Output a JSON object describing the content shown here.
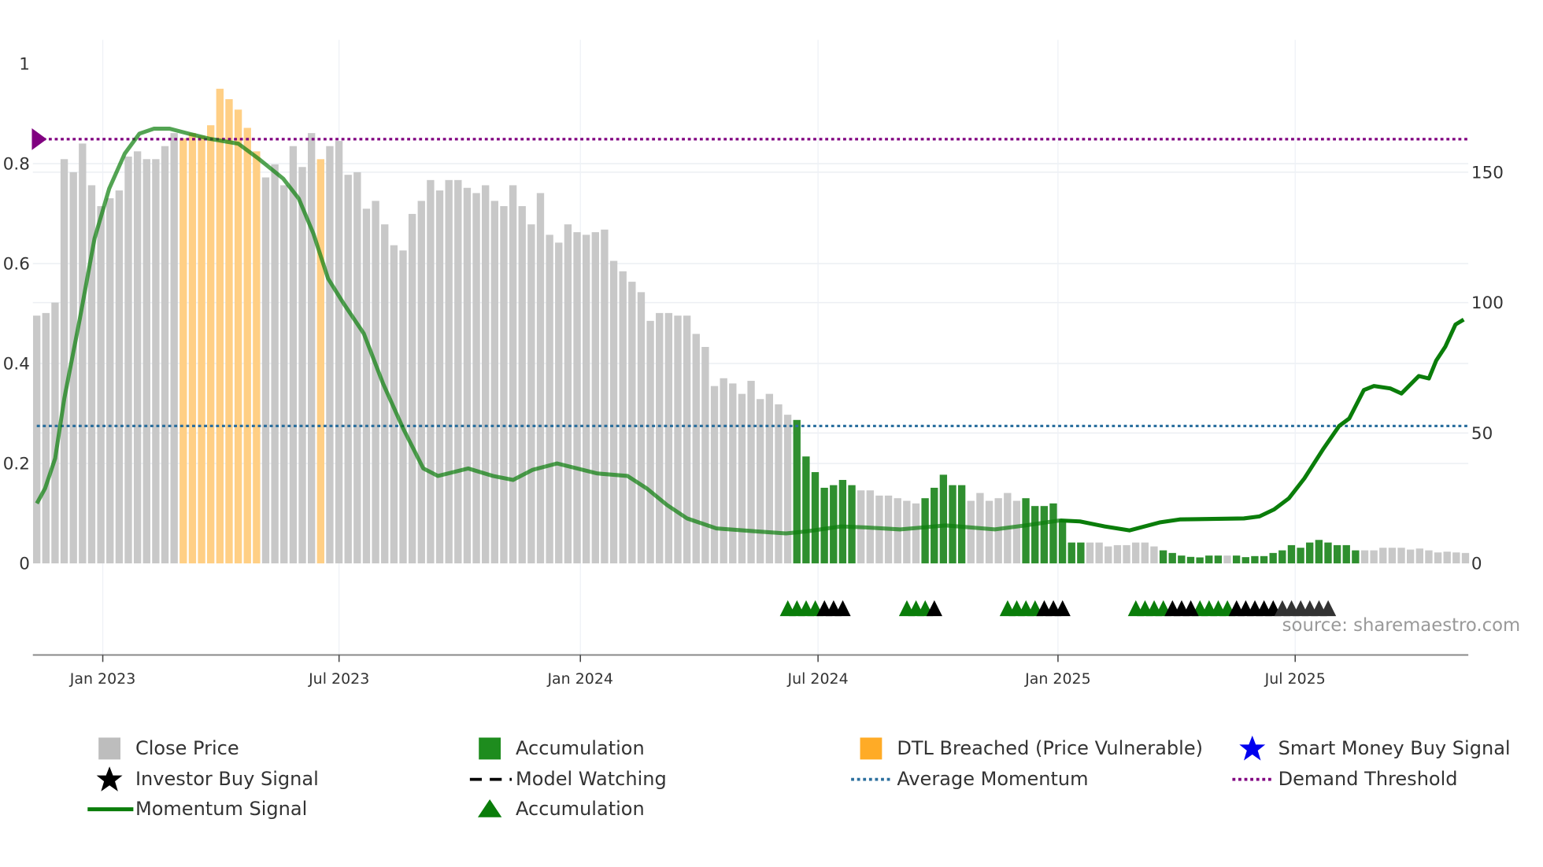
{
  "chart_data": {
    "type": "bar",
    "title": "",
    "xlabel": "",
    "ylabel_left": "",
    "ylabel_right": "",
    "x_unit": "week index (weekly bars starting mid-Nov 2022)",
    "x_ticks": [
      {
        "label": "Jan 2023",
        "week": 7.2
      },
      {
        "label": "Jul 2023",
        "week": 33.0
      },
      {
        "label": "Jan 2024",
        "week": 59.35
      },
      {
        "label": "Jul 2024",
        "week": 85.3
      },
      {
        "label": "Jan 2025",
        "week": 111.5
      },
      {
        "label": "Jul 2025",
        "week": 137.4
      }
    ],
    "y_left": {
      "range": [
        0,
        1
      ],
      "ticks": [
        "0",
        "0.2",
        "0.4",
        "0.6",
        "0.8",
        "1"
      ]
    },
    "y_right": {
      "range": [
        0,
        191.6
      ],
      "ticks": [
        "0",
        "50",
        "100",
        "150"
      ]
    },
    "close_price": [
      95,
      96,
      100,
      155,
      150,
      161,
      145,
      137,
      140,
      143,
      156,
      158,
      155,
      155,
      160,
      165,
      163,
      165,
      164,
      168,
      182,
      178,
      174,
      167,
      158,
      148,
      153,
      145,
      160,
      152,
      165,
      155,
      160,
      162,
      149,
      150,
      136,
      139,
      130,
      122,
      120,
      134,
      139,
      147,
      143,
      147,
      147,
      144,
      142,
      145,
      139,
      137,
      145,
      137,
      130,
      142,
      126,
      123,
      130,
      127,
      126,
      127,
      128,
      116,
      112,
      108,
      104,
      93,
      96,
      96,
      95,
      95,
      88,
      83,
      68,
      71,
      69,
      65,
      70,
      63,
      65,
      61,
      57,
      55,
      41,
      35,
      29,
      30,
      32,
      30,
      28,
      28,
      26,
      26,
      25,
      24,
      23,
      25,
      29,
      34,
      30,
      30,
      24,
      27,
      24,
      25,
      27,
      24,
      25,
      22,
      22,
      23,
      17,
      8,
      8,
      8,
      8,
      6.5,
      7,
      7,
      8,
      8,
      6.5,
      5,
      4,
      3,
      2.5,
      2.3,
      3,
      3,
      3,
      3,
      2.4,
      2.8,
      2.8,
      4,
      5,
      7,
      6,
      8,
      9,
      8,
      7,
      7,
      5,
      5,
      5,
      6,
      6,
      6,
      5.3,
      5.7,
      5,
      4.2,
      4.5,
      4.2,
      4
    ],
    "bar_state": "ggggggggggggggg dddddddddggggggdgggggggggggggggggggggggggggggggggggggggggggggggggggaaaaaaagggggggaaaaaggggggaaaaaaaggggggggaaaaaaagaaaaaaaaaaaaaagggggggggggggggg",
    "momentum": [
      [
        0,
        0.12
      ],
      [
        0.9,
        0.15
      ],
      [
        2,
        0.21
      ],
      [
        3,
        0.33
      ],
      [
        4.7,
        0.49
      ],
      [
        6.3,
        0.65
      ],
      [
        7.9,
        0.75
      ],
      [
        9.6,
        0.82
      ],
      [
        11.2,
        0.86
      ],
      [
        12.8,
        0.87
      ],
      [
        14.5,
        0.87
      ],
      [
        16.6,
        0.86
      ],
      [
        18.8,
        0.85
      ],
      [
        22,
        0.84
      ],
      [
        24.2,
        0.81
      ],
      [
        26.9,
        0.77
      ],
      [
        28.6,
        0.73
      ],
      [
        30.2,
        0.66
      ],
      [
        31.8,
        0.57
      ],
      [
        33.5,
        0.52
      ],
      [
        35.7,
        0.46
      ],
      [
        37.8,
        0.36
      ],
      [
        40,
        0.27
      ],
      [
        42.2,
        0.19
      ],
      [
        43.8,
        0.175
      ],
      [
        47.1,
        0.19
      ],
      [
        49.8,
        0.175
      ],
      [
        52,
        0.167
      ],
      [
        54.1,
        0.187
      ],
      [
        56.8,
        0.2
      ],
      [
        59,
        0.19
      ],
      [
        61.2,
        0.18
      ],
      [
        64.5,
        0.175
      ],
      [
        66.6,
        0.15
      ],
      [
        68.8,
        0.117
      ],
      [
        71,
        0.09
      ],
      [
        74.2,
        0.07
      ],
      [
        78.6,
        0.064
      ],
      [
        81.8,
        0.06
      ],
      [
        84,
        0.064
      ],
      [
        87.8,
        0.074
      ],
      [
        90.5,
        0.072
      ],
      [
        94.3,
        0.068
      ],
      [
        99.2,
        0.076
      ],
      [
        104.6,
        0.068
      ],
      [
        107.9,
        0.076
      ],
      [
        111.7,
        0.086
      ],
      [
        113.9,
        0.084
      ],
      [
        116.6,
        0.074
      ],
      [
        119.3,
        0.066
      ],
      [
        122.6,
        0.082
      ],
      [
        124.8,
        0.088
      ],
      [
        131.8,
        0.09
      ],
      [
        133.5,
        0.094
      ],
      [
        135.1,
        0.108
      ],
      [
        136.7,
        0.13
      ],
      [
        138.4,
        0.17
      ],
      [
        140.5,
        0.23
      ],
      [
        142.2,
        0.275
      ],
      [
        143.3,
        0.29
      ],
      [
        144.9,
        0.347
      ],
      [
        146,
        0.355
      ],
      [
        147.8,
        0.35
      ],
      [
        149,
        0.34
      ],
      [
        150.9,
        0.375
      ],
      [
        152,
        0.37
      ],
      [
        152.8,
        0.406
      ],
      [
        153.8,
        0.434
      ],
      [
        154.9,
        0.478
      ],
      [
        155.8,
        0.488
      ]
    ],
    "momentum_fade_until_week": 111.7,
    "average_momentum": 0.275,
    "model_watching_level": 0.275,
    "model_watching_until_week": 82,
    "demand_threshold": 0.849,
    "markers": {
      "accumulation": [
        82,
        83,
        84,
        85,
        95,
        96,
        97,
        106,
        107,
        108,
        109,
        120,
        121,
        122,
        123,
        127,
        128,
        129,
        130
      ],
      "investor_buy": [
        86,
        87,
        88,
        98,
        110,
        111,
        112,
        124,
        125,
        126,
        131,
        132,
        133,
        134,
        135
      ],
      "investor_buy_faded": [
        136,
        137,
        138,
        139,
        140,
        141
      ]
    },
    "colors": {
      "close": "#c8c8c8",
      "accumulation": "#2f8f2f",
      "dtl": "#ffcf85",
      "momentum": "#0a7d0a",
      "average": "#2b6f9e",
      "threshold": "#800080",
      "watching": "#000000"
    },
    "source": "source: sharemaestro.com",
    "legend": [
      "Close Price",
      "Accumulation",
      "DTL Breached (Price Vulnerable)",
      "Smart Money Buy Signal",
      "Investor Buy Signal",
      "Model Watching",
      "Average Momentum",
      "Demand Threshold",
      "Momentum Signal",
      "Accumulation"
    ]
  }
}
